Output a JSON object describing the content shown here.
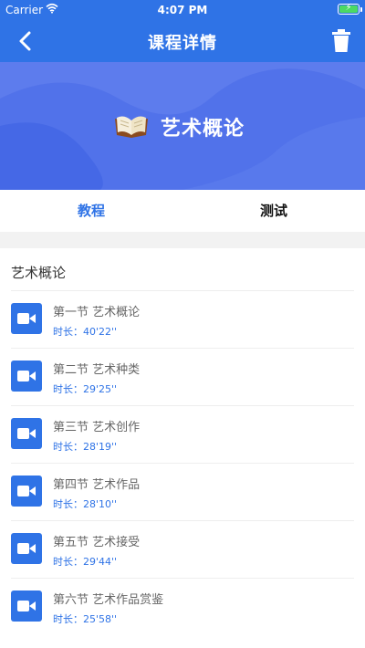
{
  "status": {
    "carrier": "Carrier",
    "time": "4:07 PM"
  },
  "nav": {
    "title": "课程详情"
  },
  "banner": {
    "title": "艺术概论"
  },
  "tabs": {
    "tutorial": "教程",
    "test": "测试"
  },
  "section": {
    "title": "艺术概论"
  },
  "lessons": [
    {
      "title": "第一节 艺术概论",
      "duration": "时长：40'22''"
    },
    {
      "title": "第二节 艺术种类",
      "duration": "时长：29'25''"
    },
    {
      "title": "第三节 艺术创作",
      "duration": "时长：28'19''"
    },
    {
      "title": "第四节 艺术作品",
      "duration": "时长：28'10''"
    },
    {
      "title": "第五节 艺术接受",
      "duration": "时长：29'44''"
    },
    {
      "title": "第六节 艺术作品赏鉴",
      "duration": "时长：25'58''"
    }
  ],
  "colors": {
    "primary": "#2f73e6",
    "banner": "#5172ea"
  }
}
